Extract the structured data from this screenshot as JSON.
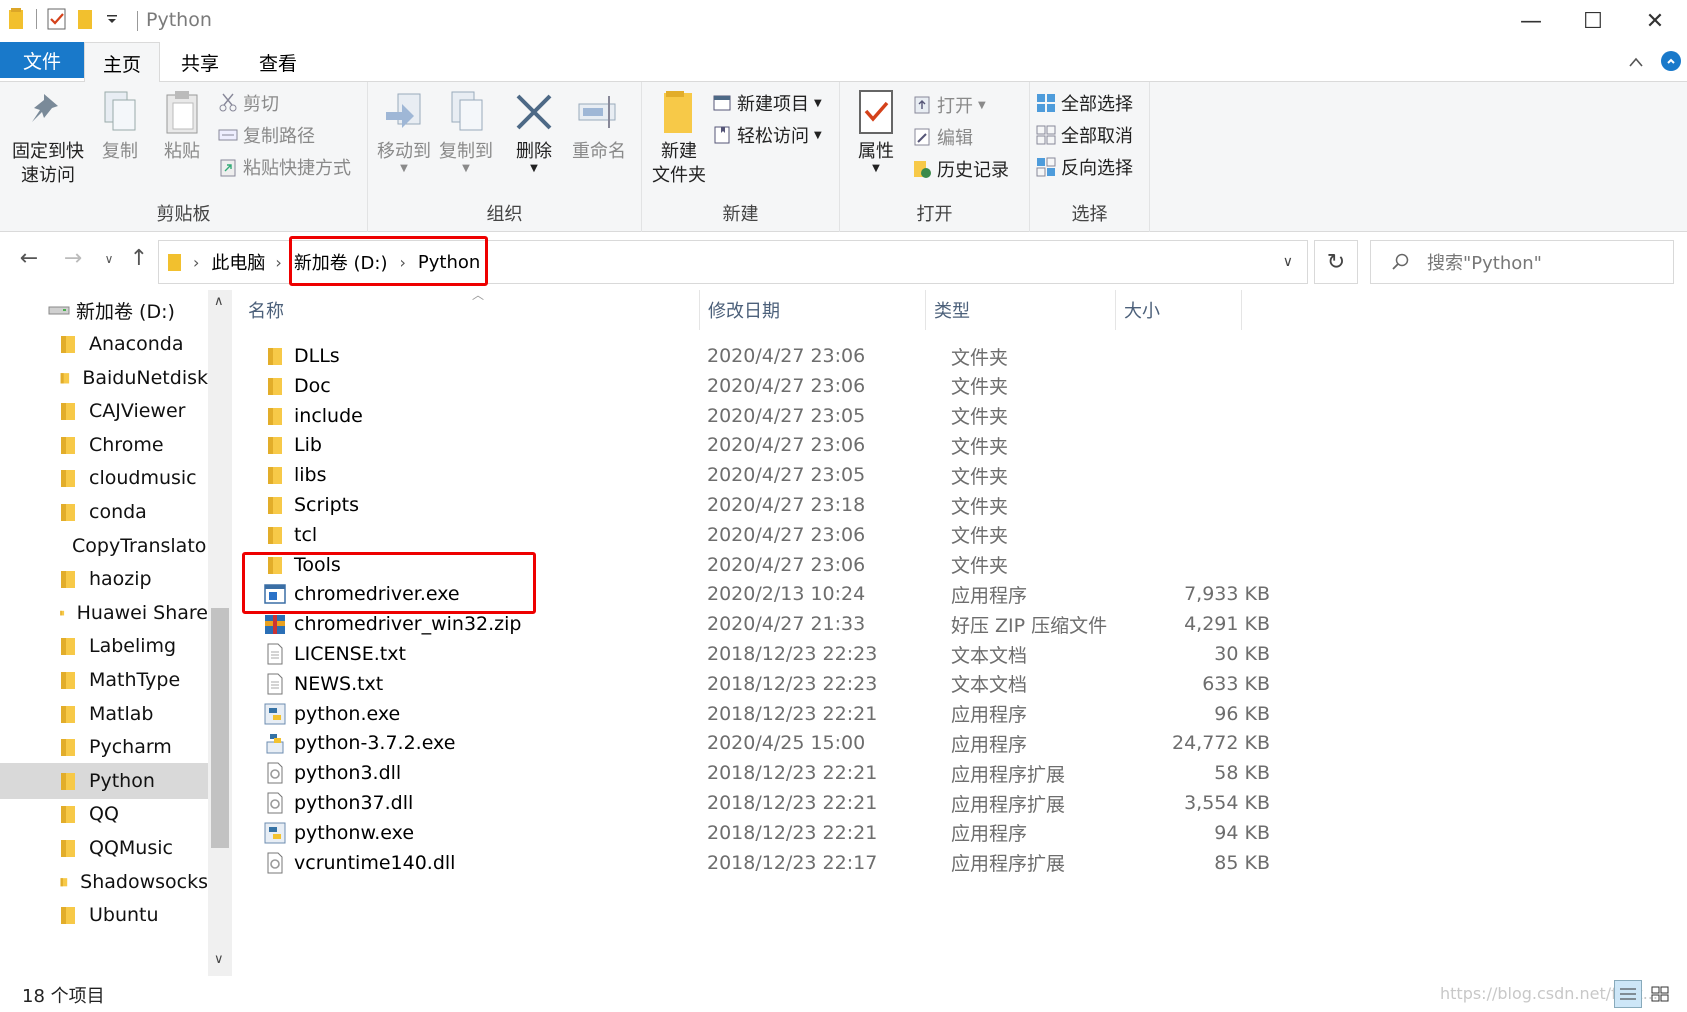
{
  "window": {
    "title": "Python",
    "minimize": "—",
    "maximize": "☐",
    "close": "✕"
  },
  "menu": {
    "file": "文件",
    "tabs": [
      "主页",
      "共享",
      "查看"
    ]
  },
  "ribbon": {
    "clipboard": {
      "label": "剪贴板",
      "pin": "固定到快\n速访问",
      "copy": "复制",
      "paste": "粘贴",
      "cut": "剪切",
      "copy_path": "复制路径",
      "paste_shortcut": "粘贴快捷方式"
    },
    "organize": {
      "label": "组织",
      "move_to": "移动到",
      "copy_to": "复制到",
      "delete": "删除",
      "rename": "重命名"
    },
    "new": {
      "label": "新建",
      "new_folder": "新建\n文件夹",
      "new_item": "新建项目",
      "easy_access": "轻松访问"
    },
    "open": {
      "label": "打开",
      "properties": "属性",
      "open": "打开",
      "edit": "编辑",
      "history": "历史记录"
    },
    "select": {
      "label": "选择",
      "select_all": "全部选择",
      "select_none": "全部取消",
      "invert": "反向选择"
    }
  },
  "address": {
    "crumbs": [
      "此电脑",
      "新加卷 (D:)",
      "Python"
    ],
    "search_placeholder": "搜索\"Python\""
  },
  "nav": {
    "drive": "新加卷 (D:)",
    "folders": [
      "Anaconda",
      "BaiduNetdisk",
      "CAJViewer",
      "Chrome",
      "cloudmusic",
      "conda",
      "CopyTranslator",
      "haozip",
      "Huawei Share",
      "Labelimg",
      "MathType",
      "Matlab",
      "Pycharm",
      "Python",
      "QQ",
      "QQMusic",
      "Shadowsocks",
      "Ubuntu"
    ],
    "selected": "Python"
  },
  "columns": {
    "name": "名称",
    "date": "修改日期",
    "type": "类型",
    "size": "大小"
  },
  "files": [
    {
      "name": "DLLs",
      "date": "2020/4/27 23:06",
      "type": "文件夹",
      "size": "",
      "icon": "folder-icon"
    },
    {
      "name": "Doc",
      "date": "2020/4/27 23:06",
      "type": "文件夹",
      "size": "",
      "icon": "folder-icon"
    },
    {
      "name": "include",
      "date": "2020/4/27 23:05",
      "type": "文件夹",
      "size": "",
      "icon": "folder-icon"
    },
    {
      "name": "Lib",
      "date": "2020/4/27 23:06",
      "type": "文件夹",
      "size": "",
      "icon": "folder-icon"
    },
    {
      "name": "libs",
      "date": "2020/4/27 23:05",
      "type": "文件夹",
      "size": "",
      "icon": "folder-icon"
    },
    {
      "name": "Scripts",
      "date": "2020/4/27 23:18",
      "type": "文件夹",
      "size": "",
      "icon": "folder-icon"
    },
    {
      "name": "tcl",
      "date": "2020/4/27 23:06",
      "type": "文件夹",
      "size": "",
      "icon": "folder-icon"
    },
    {
      "name": "Tools",
      "date": "2020/4/27 23:06",
      "type": "文件夹",
      "size": "",
      "icon": "folder-icon"
    },
    {
      "name": "chromedriver.exe",
      "date": "2020/2/13 10:24",
      "type": "应用程序",
      "size": "7,933 KB",
      "icon": "exe-icon"
    },
    {
      "name": "chromedriver_win32.zip",
      "date": "2020/4/27 21:33",
      "type": "好压 ZIP 压缩文件",
      "size": "4,291 KB",
      "icon": "zip-icon"
    },
    {
      "name": "LICENSE.txt",
      "date": "2018/12/23 22:23",
      "type": "文本文档",
      "size": "30 KB",
      "icon": "text-file-icon"
    },
    {
      "name": "NEWS.txt",
      "date": "2018/12/23 22:23",
      "type": "文本文档",
      "size": "633 KB",
      "icon": "text-file-icon"
    },
    {
      "name": "python.exe",
      "date": "2018/12/23 22:21",
      "type": "应用程序",
      "size": "96 KB",
      "icon": "python-icon"
    },
    {
      "name": "python-3.7.2.exe",
      "date": "2020/4/25 15:00",
      "type": "应用程序",
      "size": "24,772 KB",
      "icon": "installer-icon"
    },
    {
      "name": "python3.dll",
      "date": "2018/12/23 22:21",
      "type": "应用程序扩展",
      "size": "58 KB",
      "icon": "dll-icon"
    },
    {
      "name": "python37.dll",
      "date": "2018/12/23 22:21",
      "type": "应用程序扩展",
      "size": "3,554 KB",
      "icon": "dll-icon"
    },
    {
      "name": "pythonw.exe",
      "date": "2018/12/23 22:21",
      "type": "应用程序",
      "size": "94 KB",
      "icon": "python-icon"
    },
    {
      "name": "vcruntime140.dll",
      "date": "2018/12/23 22:17",
      "type": "应用程序扩展",
      "size": "85 KB",
      "icon": "dll-icon"
    }
  ],
  "status": {
    "count": "18 个项目",
    "watermark": "https://blog.csdn.net/feat..."
  },
  "colors": {
    "accent": "#1979ca",
    "highlight": "#e00000",
    "folder": "#f7c948"
  }
}
